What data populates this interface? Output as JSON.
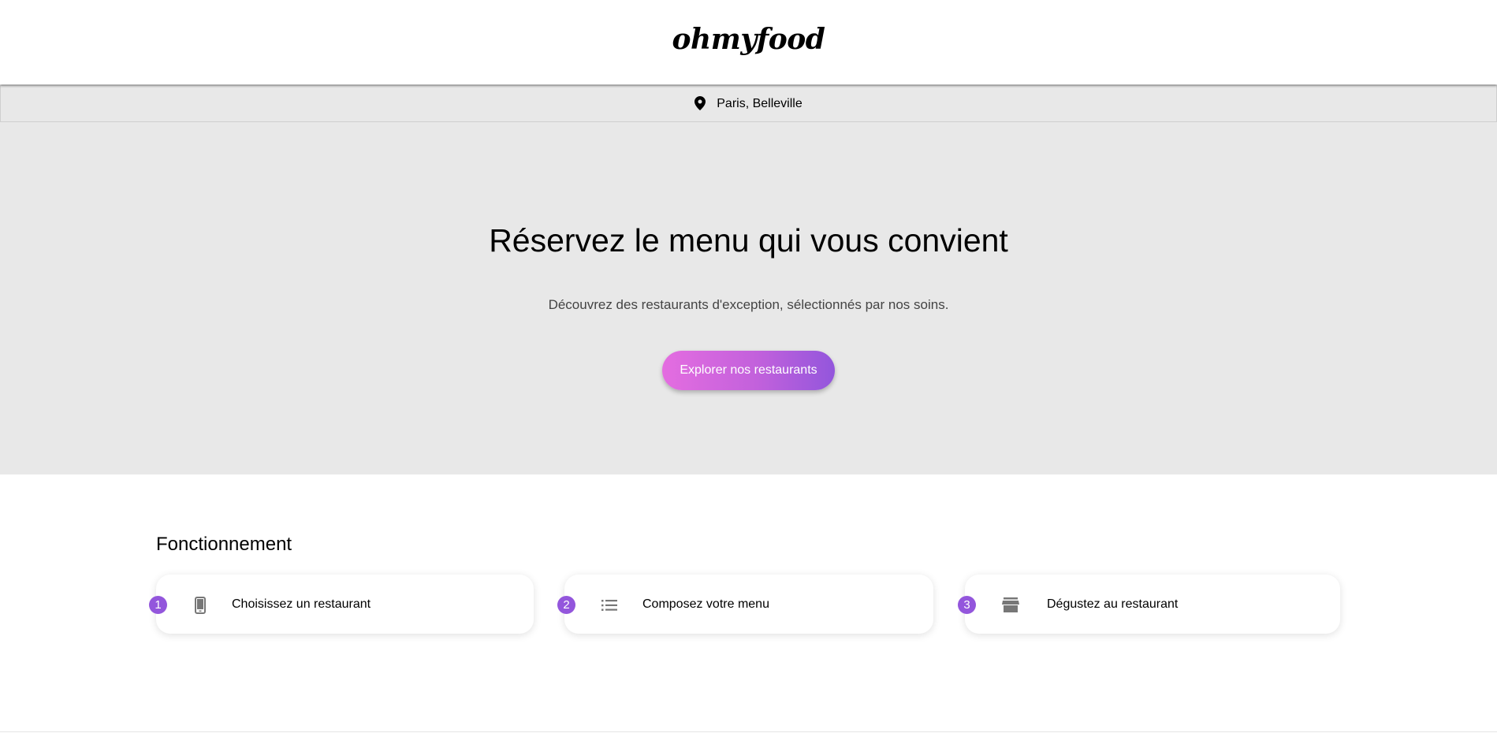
{
  "header": {
    "logo": "ohmyfood"
  },
  "location": {
    "icon": "map-pin-icon",
    "text": "Paris, Belleville"
  },
  "hero": {
    "title": "Réservez le menu qui vous convient",
    "subtitle": "Découvrez des restaurants d'exception, sélectionnés par nos soins.",
    "cta_label": "Explorer nos restaurants"
  },
  "how_it_works": {
    "title": "Fonctionnement",
    "steps": [
      {
        "number": "1",
        "icon": "smartphone-icon",
        "label": "Choisissez un restaurant"
      },
      {
        "number": "2",
        "icon": "list-icon",
        "label": "Composez votre menu"
      },
      {
        "number": "3",
        "icon": "storefront-icon",
        "label": "Dégustez au restaurant"
      }
    ]
  },
  "colors": {
    "accent_purple": "#9356dc",
    "accent_pink": "#e46de0",
    "hero_background": "#e8e8e8"
  }
}
